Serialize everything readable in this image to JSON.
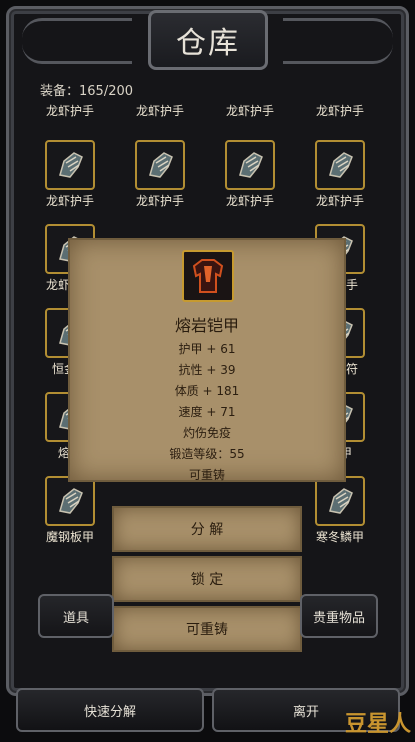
{
  "window": {
    "title": "仓库"
  },
  "inventory": {
    "count_label": "装备：165/200"
  },
  "grid_rows": [
    [
      "龙虾护手",
      "龙虾护手",
      "龙虾护手",
      "龙虾护手"
    ],
    [
      "龙虾护手",
      "龙虾护手",
      "龙虾护手",
      "龙虾护手"
    ],
    [
      "龙虾护手",
      "",
      "",
      "虾护手"
    ],
    [
      "恒金海",
      "",
      "",
      "北护符"
    ],
    [
      "熔岩",
      "",
      "",
      "板甲"
    ],
    [
      "魔钢板甲",
      "",
      "",
      "寒冬鳞甲"
    ]
  ],
  "tooltip": {
    "item_name": "熔岩铠甲",
    "stats": [
      "护甲 + 61",
      "抗性 + 39",
      "体质 + 181",
      "速度 + 71",
      "灼伤免疫",
      "锻造等级：55",
      "可重铸"
    ]
  },
  "actions": {
    "decompose": "分 解",
    "lock": "锁 定",
    "reforge": "可重铸"
  },
  "tabs": {
    "props": "道具",
    "valuables": "贵重物品"
  },
  "footer": {
    "quick_decompose": "快速分解",
    "leave": "离开"
  },
  "watermark": "豆星人",
  "colors": {
    "slot_border": "#b28e33",
    "parchment": "#a8906a"
  },
  "icons": [
    "gauntlet-icon",
    "armor-icon"
  ]
}
